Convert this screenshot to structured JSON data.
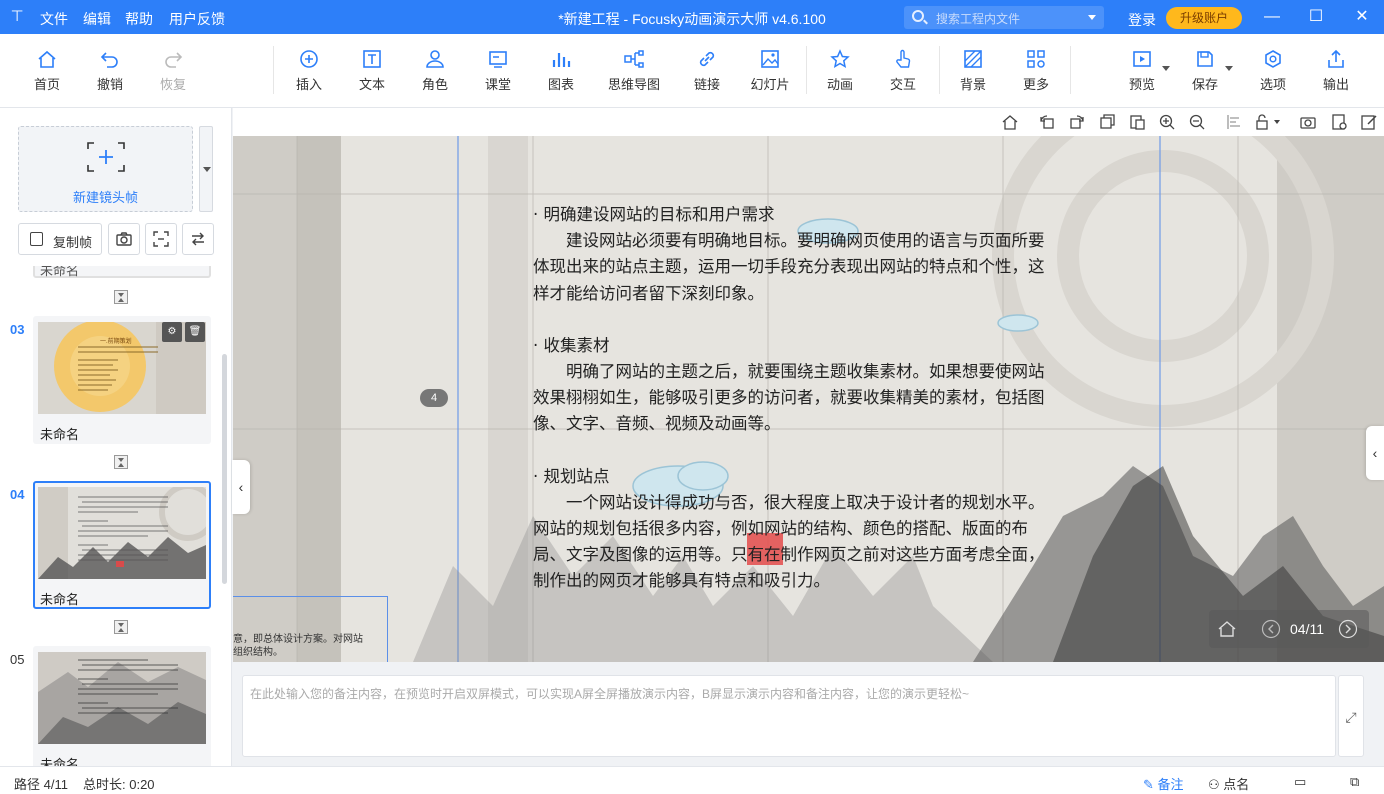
{
  "titlebar": {
    "menus": [
      "文件",
      "编辑",
      "帮助",
      "用户反馈"
    ],
    "title": "*新建工程 - Focusky动画演示大师  v4.6.100",
    "search_placeholder": "搜索工程内文件",
    "login": "登录",
    "upgrade": "升级账户",
    "accent": "#2d7ff9"
  },
  "toolbar": {
    "home": "首页",
    "undo": "撤销",
    "redo": "恢复",
    "insert": "插入",
    "text": "文本",
    "role": "角色",
    "classroom": "课堂",
    "chart": "图表",
    "mindmap": "思维导图",
    "link": "链接",
    "slide": "幻灯片",
    "animation": "动画",
    "interaction": "交互",
    "background": "背景",
    "more": "更多",
    "preview": "预览",
    "save": "保存",
    "options": "选项",
    "export": "输出"
  },
  "leftpanel": {
    "new_frame": "新建镜头帧",
    "copy_frame": "复制帧",
    "prev_label_partial": "未命名",
    "frames": [
      {
        "num": "03",
        "label": "未命名",
        "thumb_title": "一.前期策划"
      },
      {
        "num": "04",
        "label": "未命名"
      },
      {
        "num": "05",
        "label": "未命名"
      }
    ]
  },
  "canvas": {
    "frame_badge": "4",
    "sections": [
      {
        "heading": "· 明确建设网站的目标和用户需求",
        "body_first": "建设网站必须要有明确地目标。要明确网页使用的语言与页面所要",
        "body_rest": [
          "体现出来的站点主题，运用一切手段充分表现出网站的特点和个性，这",
          "样才能给访问者留下深刻印象。"
        ]
      },
      {
        "heading": "· 收集素材",
        "body_first": "明确了网站的主题之后，就要围绕主题收集素材。如果想要使网站",
        "body_rest": [
          "效果栩栩如生，能够吸引更多的访问者，就要收集精美的素材，包括图",
          "像、文字、音频、视频及动画等。"
        ]
      },
      {
        "heading": "· 规划站点",
        "body_first": "一个网站设计得成功与否，很大程度上取决于设计者的规划水平。",
        "body_rest": [
          "网站的规划包括很多内容，例如网站的结构、颜色的搭配、版面的布",
          "局、文字及图像的运用等。只有在制作网页之前对这些方面考虑全面，",
          "制作出的网页才能够具有特点和吸引力。"
        ]
      }
    ],
    "peek_text": [
      "意，即总体设计方案。对网站",
      "组织结构。"
    ],
    "pager": "04/11"
  },
  "notes": {
    "placeholder": "在此处输入您的备注内容，在预览时开启双屏模式，可以实现A屏全屏播放演示内容，B屏显示演示内容和备注内容，让您的演示更轻松~"
  },
  "statusbar": {
    "path": "路径 4/11",
    "duration": "总时长: 0:20",
    "notes": "备注",
    "rollcall": "点名"
  }
}
